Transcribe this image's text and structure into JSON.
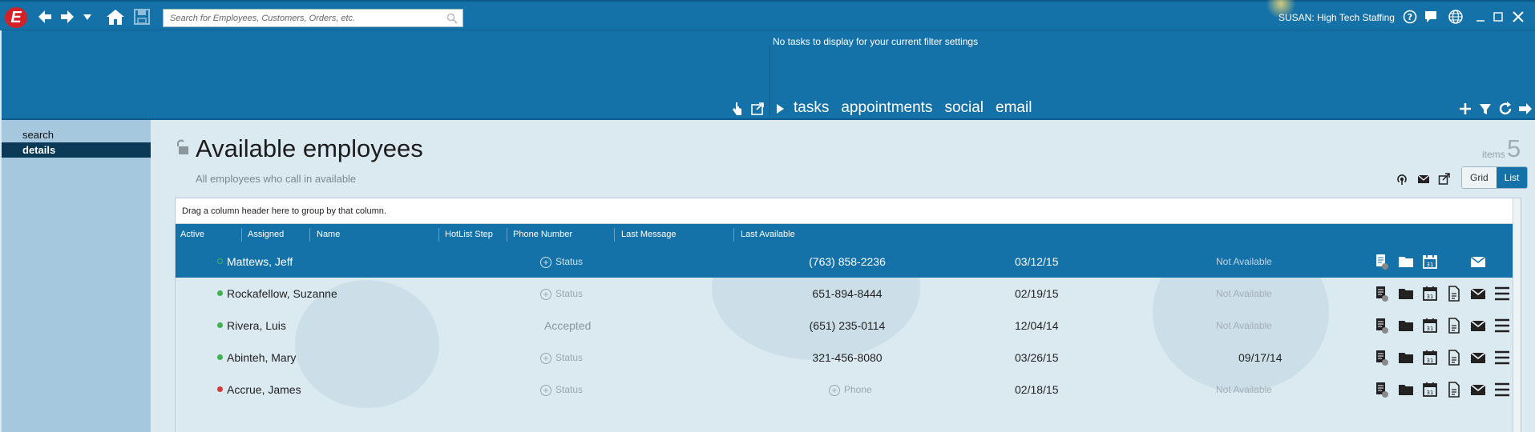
{
  "app": {
    "logo_letter": "E",
    "search_placeholder": "Search for Employees, Customers, Orders, etc.",
    "user_label": "SUSAN: High Tech Staffing"
  },
  "task_panel": {
    "empty_message": "No tasks to display for your current filter settings",
    "tabs": [
      {
        "label": "tasks",
        "active": true
      },
      {
        "label": "appointments",
        "active": false
      },
      {
        "label": "social",
        "active": false
      },
      {
        "label": "email",
        "active": false
      }
    ]
  },
  "nav": {
    "items": [
      {
        "label": "search",
        "active": false
      },
      {
        "label": "details",
        "active": true
      }
    ]
  },
  "page": {
    "title": "Available employees",
    "subtitle": "All employees who call in available",
    "items_label": "items",
    "items_count": "5",
    "view_grid": "Grid",
    "view_list": "List"
  },
  "grid": {
    "group_hint": "Drag a column header here to group by that column.",
    "columns": [
      "Active",
      "Assigned",
      "Name",
      "HotList Step",
      "Phone Number",
      "Last Message",
      "Last Available"
    ],
    "rows": [
      {
        "active_color": "#3fb34f",
        "active_hollow": true,
        "name": "Mattews, Jeff",
        "hotlist": "Status",
        "hotlist_plus": true,
        "phone": "(763) 858-2236",
        "last_message": "03/12/15",
        "last_available": "Not Available",
        "la_muted": true,
        "selected": true
      },
      {
        "active_color": "#3fb34f",
        "active_hollow": false,
        "name": "Rockafellow, Suzanne",
        "hotlist": "Status",
        "hotlist_plus": true,
        "phone": "651-894-8444",
        "last_message": "02/19/15",
        "last_available": "Not Available",
        "la_muted": true,
        "selected": false
      },
      {
        "active_color": "#3fb34f",
        "active_hollow": false,
        "name": "Rivera, Luis",
        "hotlist": "Accepted",
        "hotlist_plus": false,
        "phone": "(651) 235-0114",
        "last_message": "12/04/14",
        "last_available": "Not Available",
        "la_muted": true,
        "selected": false
      },
      {
        "active_color": "#3fb34f",
        "active_hollow": false,
        "name": "Abinteh, Mary",
        "hotlist": "Status",
        "hotlist_plus": true,
        "phone": "321-456-8080",
        "last_message": "03/26/15",
        "last_available": "09/17/14",
        "la_muted": false,
        "selected": false
      },
      {
        "active_color": "#d23a3a",
        "active_hollow": false,
        "name": "Accrue, James",
        "hotlist": "Status",
        "hotlist_plus": true,
        "phone": "Phone",
        "phone_plus": true,
        "last_message": "02/18/15",
        "last_available": "Not Available",
        "la_muted": true,
        "selected": false
      }
    ],
    "row_icons": [
      "notes-icon",
      "folder-icon",
      "calendar-icon",
      "document-icon",
      "envelope-icon",
      "menu-icon"
    ]
  }
}
